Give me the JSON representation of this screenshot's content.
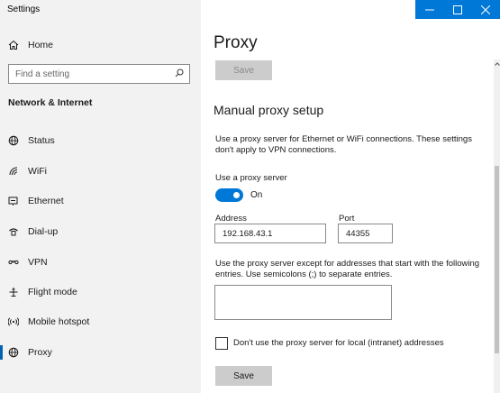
{
  "app": {
    "title": "Settings"
  },
  "sidebar": {
    "home_label": "Home",
    "search_placeholder": "Find a setting",
    "section_title": "Network & Internet",
    "items": [
      {
        "label": "Status",
        "icon": "globe-status-icon"
      },
      {
        "label": "WiFi",
        "icon": "wifi-icon"
      },
      {
        "label": "Ethernet",
        "icon": "ethernet-icon"
      },
      {
        "label": "Dial-up",
        "icon": "dial-up-icon"
      },
      {
        "label": "VPN",
        "icon": "vpn-icon"
      },
      {
        "label": "Flight mode",
        "icon": "airplane-icon"
      },
      {
        "label": "Mobile hotspot",
        "icon": "hotspot-icon"
      },
      {
        "label": "Proxy",
        "icon": "globe-icon",
        "selected": true
      }
    ]
  },
  "titlebar": {
    "minimize": "—",
    "maximize": "☐",
    "close": "✕"
  },
  "main": {
    "page_title": "Proxy",
    "top_save_label": "Save",
    "manual_title": "Manual proxy setup",
    "manual_desc": "Use a proxy server for Ethernet or WiFi connections. These settings don't apply to VPN connections.",
    "use_proxy_label": "Use a proxy server",
    "toggle_state": "On",
    "address_label": "Address",
    "address_value": "192.168.43.1",
    "port_label": "Port",
    "port_value": "44355",
    "exceptions_desc": "Use the proxy server except for addresses that start with the following entries. Use semicolons (;) to separate entries.",
    "exceptions_value": "",
    "local_checkbox_label": "Don't use the proxy server for local (intranet) addresses",
    "local_checked": false,
    "save_label": "Save"
  },
  "colors": {
    "accent": "#0078d7",
    "sidebar_bg": "#f2f2f2",
    "button_bg": "#cccccc"
  }
}
